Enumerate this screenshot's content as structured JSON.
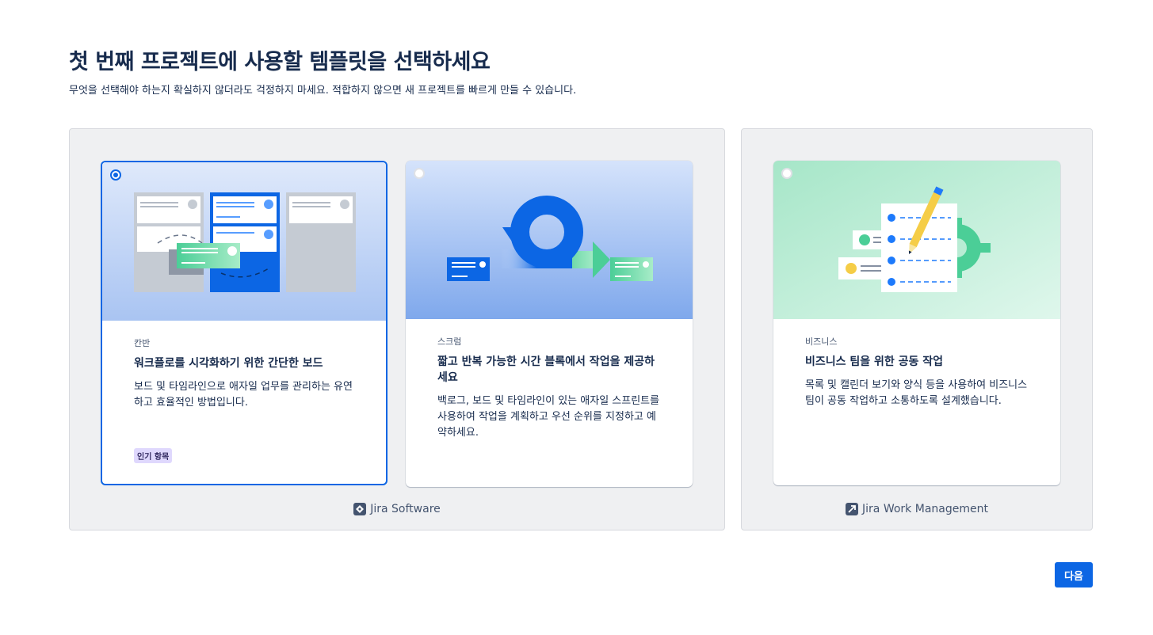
{
  "header": {
    "title": "첫 번째 프로젝트에 사용할 템플릿을 선택하세요",
    "subtitle": "무엇을 선택해야 하는지 확실하지 않더라도 걱정하지 마세요. 적합하지 않으면 새 프로젝트를 빠르게 만들 수 있습니다."
  },
  "groups": [
    {
      "product": "Jira Software",
      "icon": "jira-software-icon",
      "cards": [
        {
          "category": "칸반",
          "title": "워크플로를 시각화하기 위한 간단한 보드",
          "description": "보드 및 타임라인으로 애자일 업무를 관리하는 유연하고 효율적인 방법입니다.",
          "badge": "인기 항목",
          "selected": true,
          "hero_color": "#dbe6fb"
        },
        {
          "category": "스크럼",
          "title": "짧고 반복 가능한 시간 블록에서 작업을 제공하세요",
          "description": "백로그, 보드 및 타임라인이 있는 애자일 스프린트를 사용하여 작업을 계획하고 우선 순위를 지정하고 예약하세요.",
          "selected": false,
          "hero_color": "#c7d8f7"
        }
      ]
    },
    {
      "product": "Jira Work Management",
      "icon": "jira-work-management-icon",
      "cards": [
        {
          "category": "비즈니스",
          "title": "비즈니스 팀을 위한 공동 작업",
          "description": "목록 및 캘린더 보기와 양식 등을 사용하여 비즈니스 팀이 공동 작업하고 소통하도록 설계했습니다.",
          "selected": false,
          "hero_color": "#b8ecd4"
        }
      ]
    }
  ],
  "footer": {
    "next_label": "다음"
  },
  "colors": {
    "primary": "#0c66e4",
    "text": "#172b4d",
    "group_bg": "#eff0f2",
    "green": "#4bce97",
    "yellow": "#f5cd47"
  }
}
